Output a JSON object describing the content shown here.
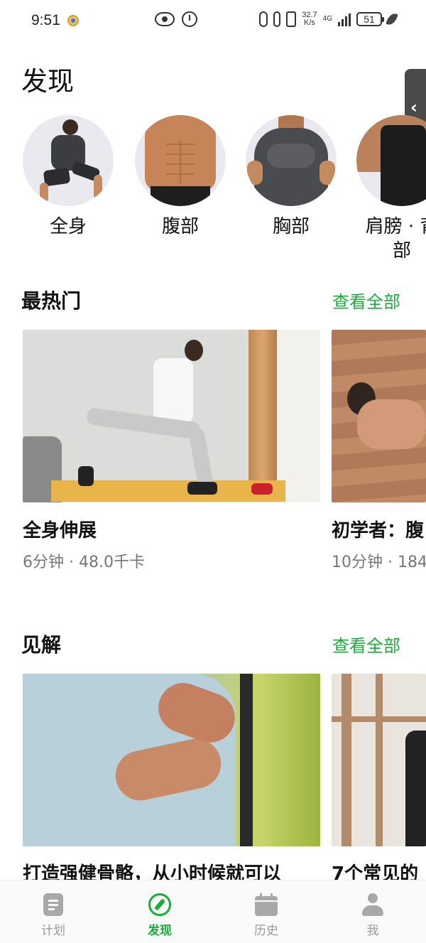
{
  "status_bar": {
    "time": "9:51",
    "net_speed_value": "32.7",
    "net_speed_unit": "K/s",
    "network": "4G",
    "battery": "51"
  },
  "page_title": "发现",
  "categories": [
    {
      "label": "全身"
    },
    {
      "label": "腹部"
    },
    {
      "label": "胸部"
    },
    {
      "label": "肩膀 · 背部"
    }
  ],
  "popular": {
    "title": "最热门",
    "see_all": "查看全部",
    "cards": [
      {
        "title": "全身伸展",
        "meta": "6分钟 · 48.0千卡"
      },
      {
        "title": "初学者：腹",
        "meta": "10分钟 · 184"
      }
    ]
  },
  "insights": {
    "title": "见解",
    "see_all": "查看全部",
    "cards": [
      {
        "title": "打造强健骨骼，从小时候就可以"
      },
      {
        "title": "7个常见的"
      }
    ]
  },
  "bottom_nav": {
    "items": [
      {
        "label": "计划",
        "icon": "plan-icon",
        "active": false
      },
      {
        "label": "发现",
        "icon": "compass-icon",
        "active": true
      },
      {
        "label": "历史",
        "icon": "calendar-icon",
        "active": false
      },
      {
        "label": "我",
        "icon": "person-icon",
        "active": false
      }
    ]
  },
  "colors": {
    "accent": "#1aad3b",
    "inactive": "#9a9a9a"
  }
}
